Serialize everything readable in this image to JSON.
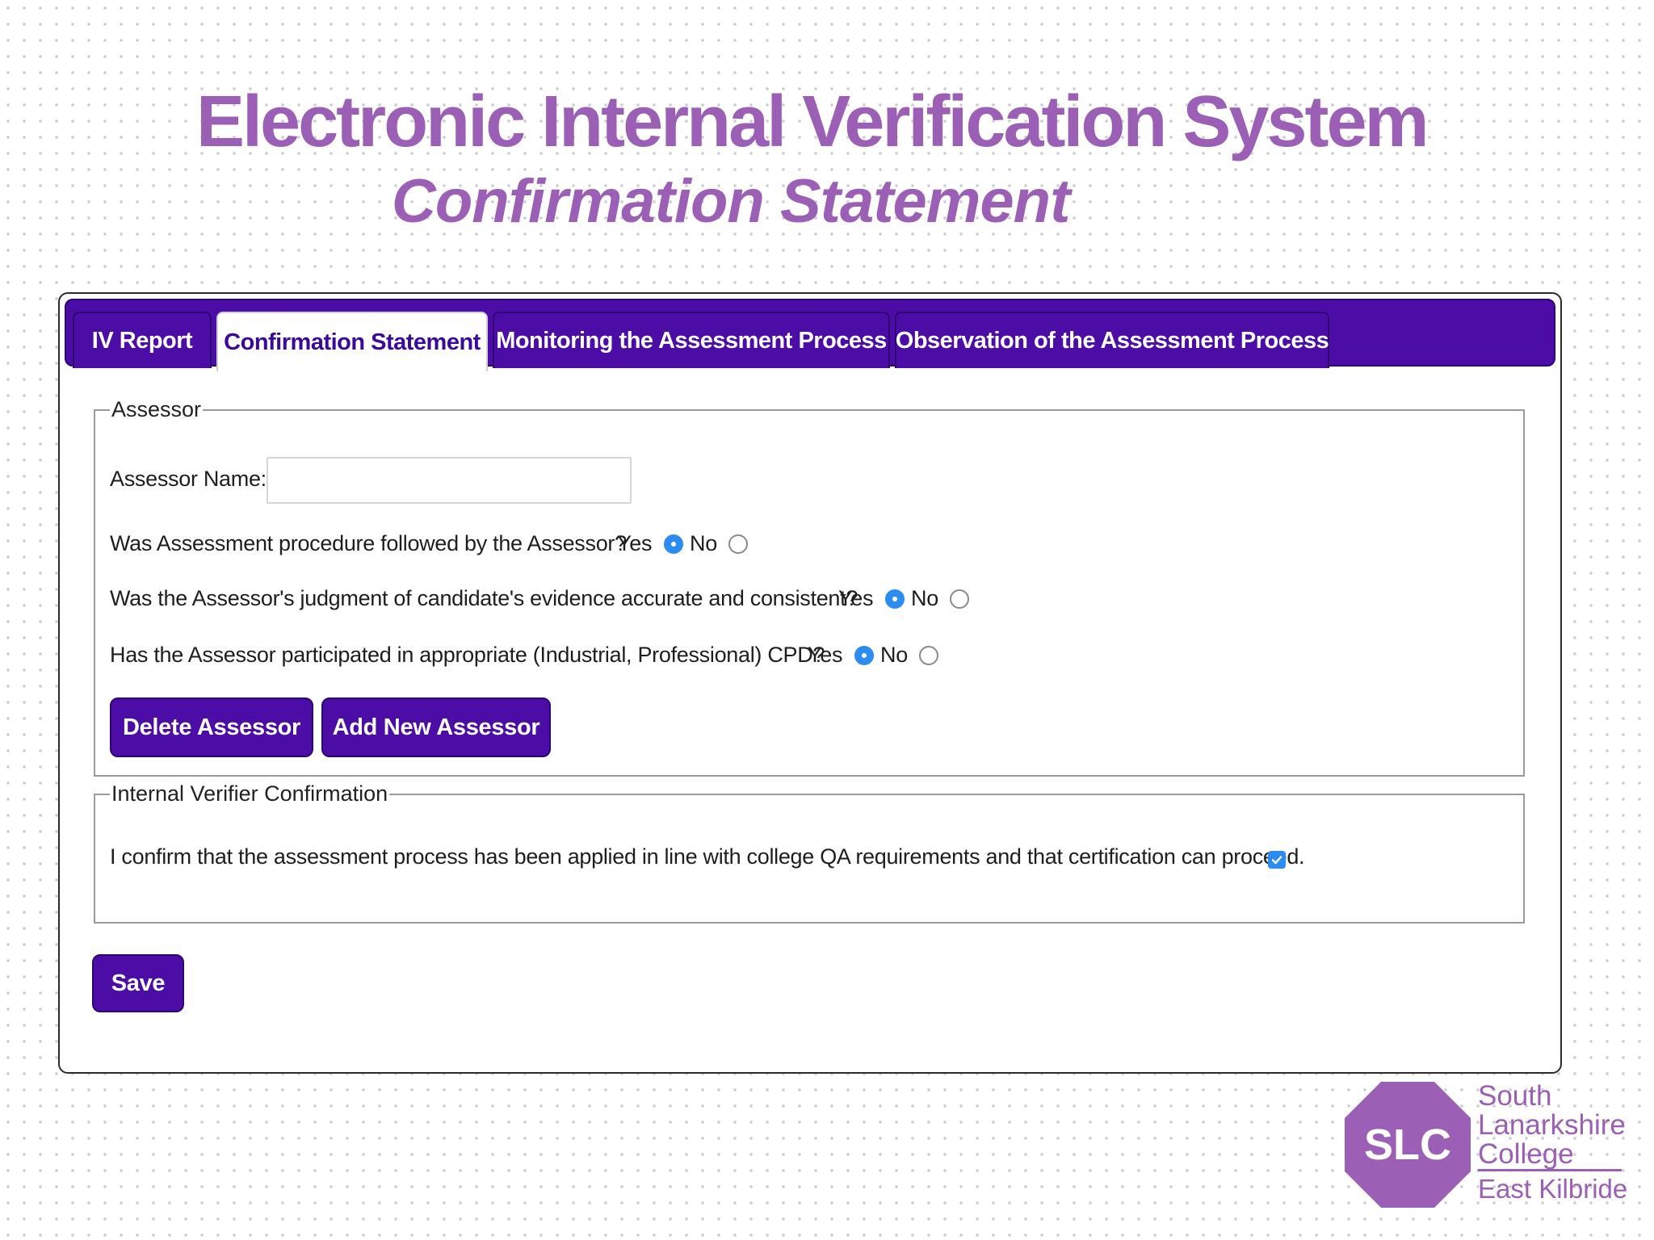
{
  "header": {
    "title": "Electronic Internal Verification System",
    "subtitle": "Confirmation Statement"
  },
  "tabs": [
    {
      "label": "IV Report",
      "active": false
    },
    {
      "label": "Confirmation Statement",
      "active": true
    },
    {
      "label": "Monitoring the Assessment Process",
      "active": false
    },
    {
      "label": "Observation of the Assessment Process",
      "active": false
    }
  ],
  "assessor": {
    "legend": "Assessor",
    "name_label": "Assessor Name:",
    "name_value": "",
    "questions": [
      {
        "text": "Was Assessment procedure followed by the Assessor?",
        "yes_label": "Yes",
        "no_label": "No",
        "selected": "Yes"
      },
      {
        "text": "Was the Assessor's judgment of candidate's evidence accurate and consistent?",
        "yes_label": "Yes",
        "no_label": "No",
        "selected": "Yes"
      },
      {
        "text": "Has the Assessor participated in appropriate (Industrial, Professional) CPD?",
        "yes_label": "Yes",
        "no_label": "No",
        "selected": "Yes"
      }
    ],
    "delete_button": "Delete Assessor",
    "add_button": "Add New Assessor"
  },
  "iv_confirmation": {
    "legend": "Internal Verifier Confirmation",
    "statement": "I confirm that the assessment process has been applied in line with college QA requirements and that certification can proceed.",
    "checked": true
  },
  "save_button": "Save",
  "logo": {
    "mark": "SLC",
    "line1": "South",
    "line2": "Lanarkshire",
    "line3": "College",
    "campus": "East Kilbride"
  },
  "colors": {
    "accent_purple": "#4b0da5",
    "title_purple": "#9b5fb5",
    "radio_blue": "#2d8cf0"
  }
}
